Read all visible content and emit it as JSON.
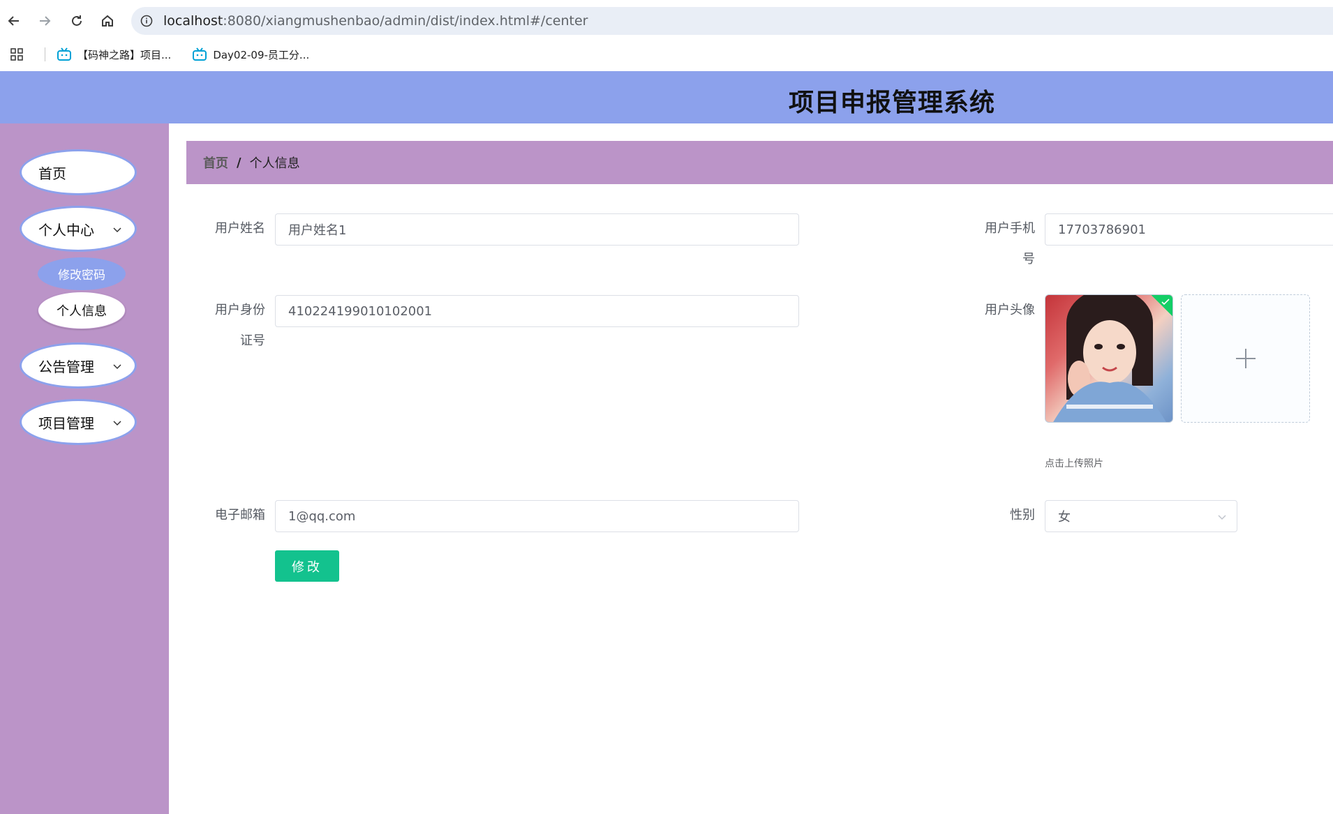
{
  "browser": {
    "url_host": "localhost",
    "url_rest": ":8080/xiangmushenbao/admin/dist/index.html#/center",
    "bookmarks": [
      {
        "label": "【码神之路】项目..."
      },
      {
        "label": "Day02-09-员工分..."
      }
    ]
  },
  "app": {
    "title": "项目申报管理系统"
  },
  "sidebar": {
    "items": [
      {
        "label": "首页"
      },
      {
        "label": "个人中心"
      },
      {
        "label": "修改密码"
      },
      {
        "label": "个人信息"
      },
      {
        "label": "公告管理"
      },
      {
        "label": "项目管理"
      }
    ]
  },
  "breadcrumb": {
    "home": "首页",
    "separator": "/",
    "current": "个人信息"
  },
  "form": {
    "name_label": "用户姓名",
    "name_value": "用户姓名1",
    "phone_label_line1": "用户手机",
    "phone_label_line2": "号",
    "phone_value": "17703786901",
    "id_label_line1": "用户身份",
    "id_label_line2": "证号",
    "id_value": "410224199010102001",
    "avatar_label": "用户头像",
    "upload_tip": "点击上传照片",
    "email_label": "电子邮箱",
    "email_value": "1@qq.com",
    "gender_label": "性别",
    "gender_value": "女",
    "submit_label": "修改"
  },
  "colors": {
    "header_bg": "#8ca1ec",
    "sidebar_bg": "#bb94c8",
    "submit_bg": "#13c28e"
  }
}
